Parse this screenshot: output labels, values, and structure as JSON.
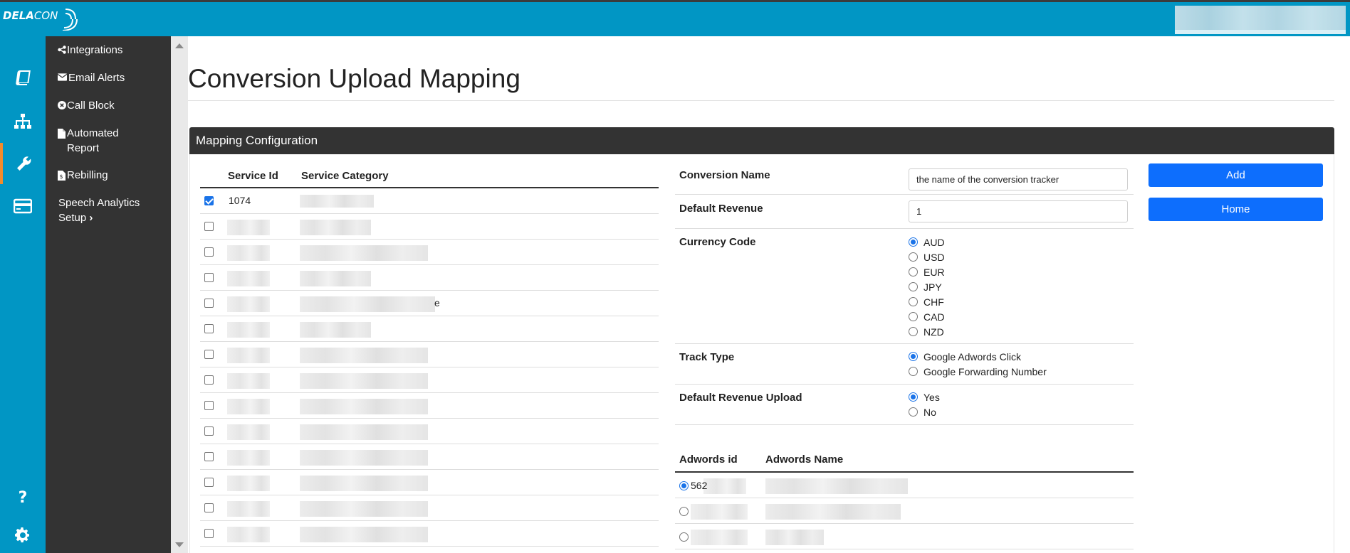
{
  "brand": {
    "logo_bold": "DELA",
    "logo_light": "CON"
  },
  "rail": [
    "book-icon",
    "sitemap-icon",
    "wrench-icon",
    "credit-card-icon",
    "question-icon",
    "gear-icon"
  ],
  "menu": {
    "items": [
      {
        "label": "Integrations",
        "icon": "share-icon"
      },
      {
        "label": "Email Alerts",
        "icon": "envelope-icon"
      },
      {
        "label": "Call Block",
        "icon": "x-circle-icon"
      },
      {
        "label": "Automated Report",
        "icon": "file-icon"
      },
      {
        "label": "Rebilling",
        "icon": "invoice-icon"
      },
      {
        "label": "Speech Analytics Setup",
        "suffix": "›"
      }
    ]
  },
  "page": {
    "title": "Conversion Upload Mapping"
  },
  "panel": {
    "title": "Mapping Configuration"
  },
  "services_table": {
    "headers": [
      "Service Id",
      "Service Category"
    ],
    "rows": [
      {
        "id": "1074",
        "checked": true,
        "cat_tail": ""
      },
      {
        "id": "",
        "checked": false,
        "cat_tail": ""
      },
      {
        "id": "",
        "checked": false,
        "cat_tail": ""
      },
      {
        "id": "",
        "checked": false,
        "cat_tail": ""
      },
      {
        "id": "",
        "checked": false,
        "cat_tail": "e"
      },
      {
        "id": "",
        "checked": false,
        "cat_tail": ""
      },
      {
        "id": "",
        "checked": false,
        "cat_tail": ""
      },
      {
        "id": "",
        "checked": false,
        "cat_tail": ""
      },
      {
        "id": "",
        "checked": false,
        "cat_tail": ""
      },
      {
        "id": "",
        "checked": false,
        "cat_tail": ""
      },
      {
        "id": "",
        "checked": false,
        "cat_tail": ""
      },
      {
        "id": "",
        "checked": false,
        "cat_tail": ""
      },
      {
        "id": "",
        "checked": false,
        "cat_tail": ""
      },
      {
        "id": "",
        "checked": false,
        "cat_tail": ""
      }
    ]
  },
  "form": {
    "conversion_name": {
      "label": "Conversion Name",
      "value": "the name of the conversion tracker"
    },
    "default_revenue": {
      "label": "Default Revenue",
      "value": "1"
    },
    "currency_code": {
      "label": "Currency Code",
      "options": [
        "AUD",
        "USD",
        "EUR",
        "JPY",
        "CHF",
        "CAD",
        "NZD"
      ],
      "selected": "AUD"
    },
    "track_type": {
      "label": "Track Type",
      "options": [
        "Google Adwords Click",
        "Google Forwarding Number"
      ],
      "selected": "Google Adwords Click"
    },
    "default_revenue_upload": {
      "label": "Default Revenue Upload",
      "options": [
        "Yes",
        "No"
      ],
      "selected": "Yes"
    }
  },
  "buttons": {
    "add": "Add",
    "home": "Home"
  },
  "adwords_table": {
    "headers": [
      "Adwords id",
      "Adwords Name"
    ],
    "rows": [
      {
        "id": "562",
        "selected": true
      },
      {
        "id": "",
        "selected": false
      },
      {
        "id": "",
        "selected": false
      }
    ]
  },
  "colors": {
    "primary": "#0196c4",
    "dark": "#333333",
    "button": "#0d6efd",
    "active_accent": "#f28b2c"
  }
}
